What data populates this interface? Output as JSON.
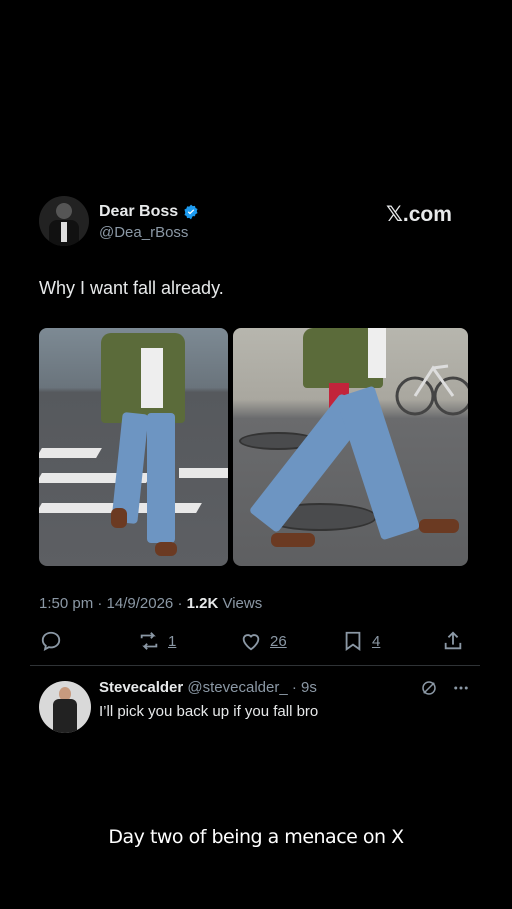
{
  "tweet": {
    "author_name": "Dear Boss",
    "author_handle": "@Dea_rBoss",
    "brand": "𝕏.com",
    "text": "Why I want fall already.",
    "time": "1:50 pm",
    "date": "14/9/2026",
    "views_count": "1.2K",
    "views_label": "Views",
    "retweets": "1",
    "likes": "26",
    "bookmarks": "4",
    "icons": [
      "reply-icon",
      "retweet-icon",
      "like-icon",
      "bookmark-icon",
      "share-icon"
    ]
  },
  "reply": {
    "name": "Stevecalder",
    "handle": "@stevecalder_",
    "age": "· 9s",
    "text": "I’ll pick you back up if you fall bro"
  },
  "caption": "Day two of being a menace on X",
  "colors": {
    "background": "#000000",
    "text": "#e7e9ea",
    "muted": "#8b98a5",
    "verified": "#1d9bf0"
  }
}
